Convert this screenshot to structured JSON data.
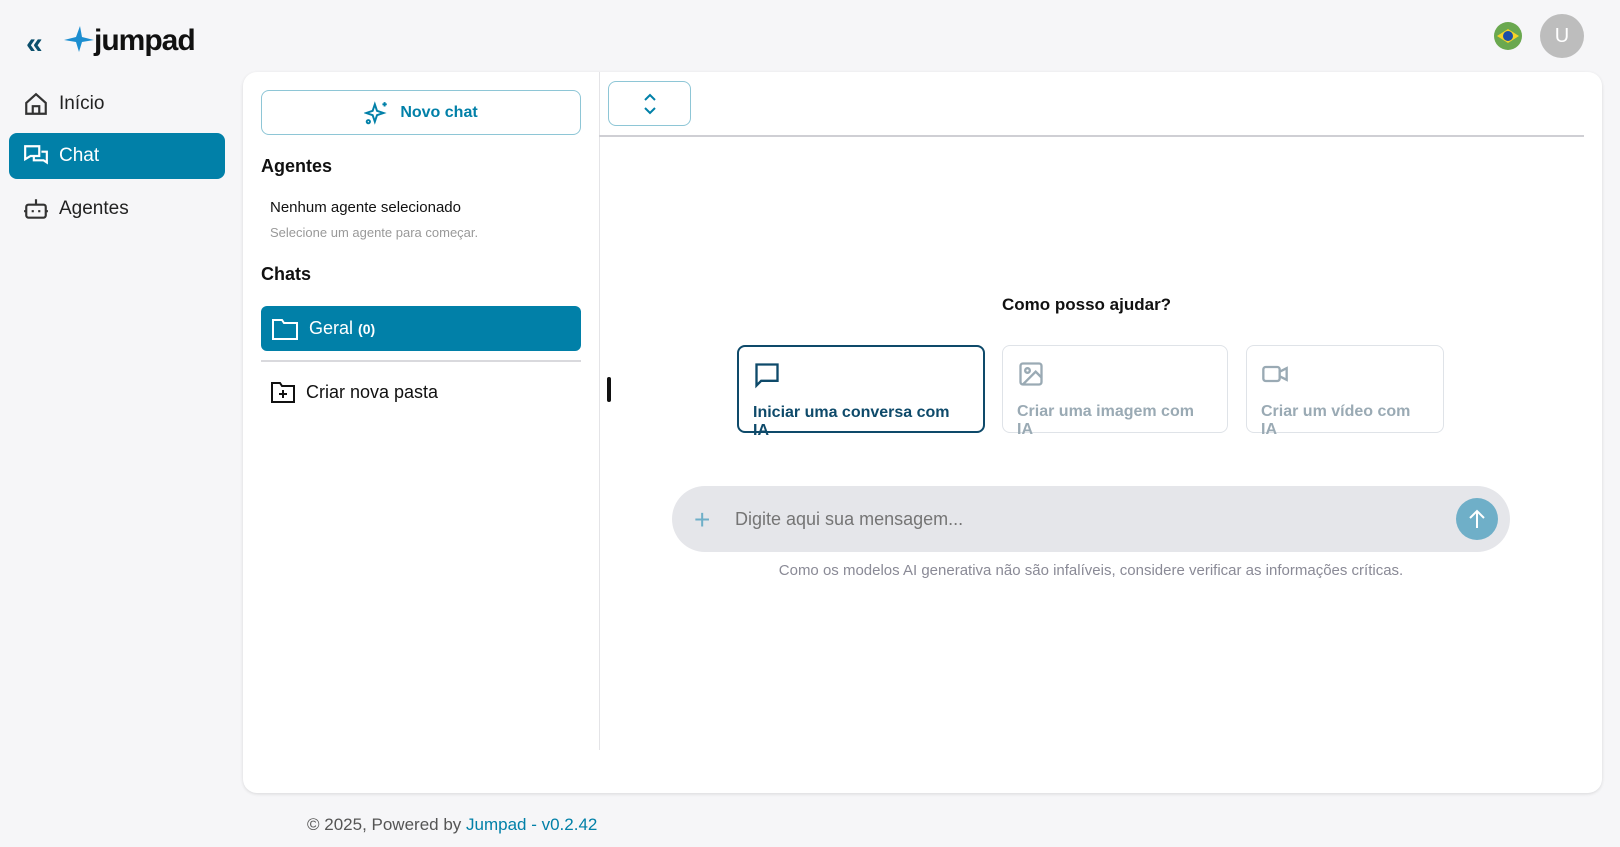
{
  "brand": {
    "name": "jumpad"
  },
  "sidebar": {
    "items": [
      {
        "label": "Início",
        "icon": "home-icon"
      },
      {
        "label": "Chat",
        "icon": "chat-icon"
      },
      {
        "label": "Agentes",
        "icon": "robot-icon"
      }
    ]
  },
  "header": {
    "avatar_initial": "U",
    "language": "pt-BR"
  },
  "panel": {
    "new_chat": "Novo chat",
    "agents_heading": "Agentes",
    "no_agent": "Nenhum agente selecionado",
    "no_agent_hint": "Selecione um agente para começar.",
    "chats_heading": "Chats",
    "folder": {
      "name": "Geral",
      "count": "(0)"
    },
    "create_folder": "Criar nova pasta"
  },
  "main": {
    "prompt_title": "Como posso ajudar?",
    "options": [
      {
        "label": "Iniciar uma conversa com IA"
      },
      {
        "label": "Criar uma imagem com IA"
      },
      {
        "label": "Criar um vídeo com IA"
      }
    ],
    "input_placeholder": "Digite aqui sua mensagem...",
    "disclaimer": "Como os modelos AI generativa não são infalíveis, considere verificar as informações críticas."
  },
  "footer": {
    "prefix": "© 2025, Powered by ",
    "link": "Jumpad - v0.2.42"
  },
  "colors": {
    "accent": "#0180a8",
    "dark": "#0e4a6a",
    "bg": "#f6f6f8"
  }
}
